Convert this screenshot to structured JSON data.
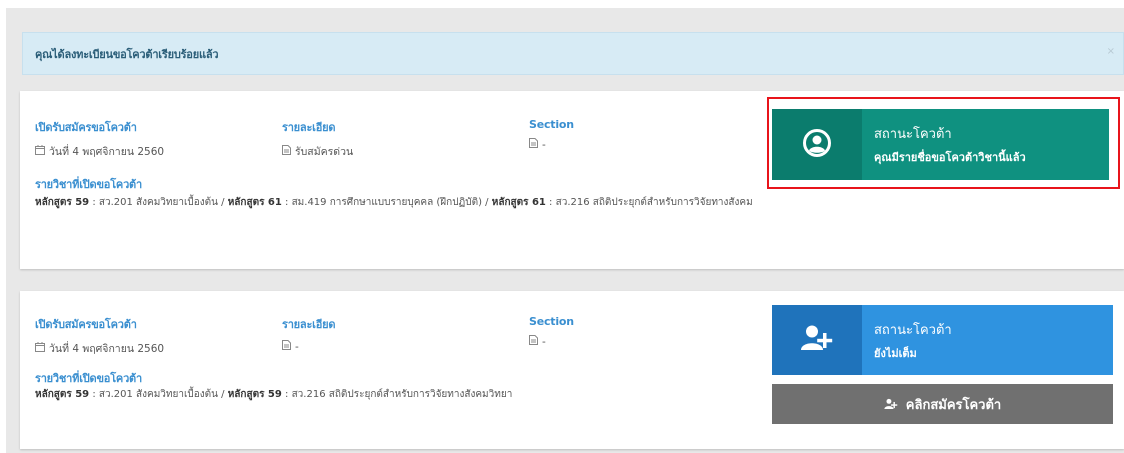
{
  "alert": {
    "message": "คุณได้ลงทะเบียนขอโควต้าเรียบร้อยแล้ว",
    "close": "×"
  },
  "cards": [
    {
      "open_label": "เปิดรับสมัครขอโควต้า",
      "open_date": "วันที่ 4 พฤศจิกายน 2560",
      "detail_label": "รายละเอียด",
      "detail_value": "รับสมัครด่วน",
      "section_label": "Section",
      "section_value": "-",
      "subjects_label": "รายวิชาที่เปิดขอโควต้า",
      "subjects": [
        {
          "curriculum": "หลักสูตร 59",
          "course": " : สว.201 สังคมวิทยาเบื้องต้น / "
        },
        {
          "curriculum": "หลักสูตร 61",
          "course": " : สม.419 การศึกษาแบบรายบุคคล (ฝึกปฏิบัติ) / "
        },
        {
          "curriculum": "หลักสูตร 61",
          "course": " : สว.216 สถิติประยุกต์สำหรับการวิจัยทางสังคม"
        }
      ],
      "status_title": "สถานะโควต้า",
      "status_message": "คุณมีรายชื่อขอโควต้าวิชานี้แล้ว"
    },
    {
      "open_label": "เปิดรับสมัครขอโควต้า",
      "open_date": "วันที่ 4 พฤศจิกายน 2560",
      "detail_label": "รายละเอียด",
      "detail_value": "-",
      "section_label": "Section",
      "section_value": "-",
      "subjects_label": "รายวิชาที่เปิดขอโควต้า",
      "subjects": [
        {
          "curriculum": "หลักสูตร 59",
          "course": " : สว.201 สังคมวิทยาเบื้องต้น / "
        },
        {
          "curriculum": "หลักสูตร 59",
          "course": " : สว.216 สถิติประยุกต์สำหรับการวิจัยทางสังคมวิทยา"
        }
      ],
      "status_title": "สถานะโควต้า",
      "status_message": "ยังไม่เต็ม",
      "apply_label": "คลิกสมัครโควต้า"
    }
  ],
  "colors": {
    "green": "#0f9180",
    "blue": "#2f93e0",
    "label_blue": "#3a8fd0",
    "alert_bg": "#d7ebf5",
    "highlight": "#e8141b",
    "button_gray": "#707070"
  },
  "icons": {
    "calendar": "calendar-icon",
    "document": "document-icon",
    "user_circle": "user-circle-icon",
    "user_add": "user-add-icon"
  }
}
